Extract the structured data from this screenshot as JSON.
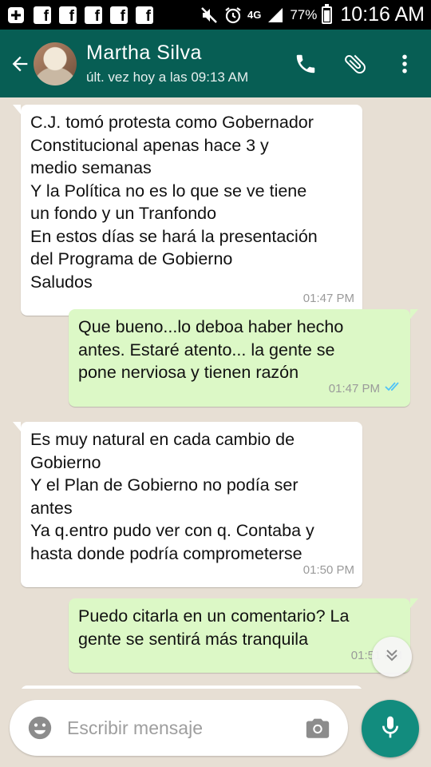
{
  "status_bar": {
    "network": "4G",
    "battery": "77%",
    "battery_level": 0.77,
    "time": "10:16 AM",
    "icons": [
      "plus-box-icon",
      "facebook-icon",
      "facebook-icon",
      "facebook-icon",
      "facebook-icon",
      "facebook-icon",
      "mute-icon",
      "alarm-icon",
      "signal-icon",
      "battery-icon"
    ]
  },
  "header": {
    "contact_name": "Martha Silva",
    "last_seen": "últ. vez hoy a las 09:13 AM",
    "icons": [
      "back-arrow-icon",
      "phone-icon",
      "paperclip-icon",
      "more-vert-icon"
    ],
    "color": "#075e54"
  },
  "messages": [
    {
      "direction": "in",
      "lines": [
        "C.J. tomó protesta como Gobernador",
        "Constitucional apenas hace 3 y",
        "medio semanas",
        "Y la Política no es lo que se ve tiene",
        "un fondo y un Tranfondo",
        "En estos días se hará la presentación",
        "del Programa de Gobierno",
        "Saludos"
      ],
      "time": "01:47 PM"
    },
    {
      "direction": "out",
      "lines": [
        "Que bueno...lo deboa haber hecho",
        "antes. Estaré atento... la gente se",
        "pone nerviosa y tienen razón"
      ],
      "time": "01:47 PM",
      "read": true
    },
    {
      "direction": "in",
      "lines": [
        "Es muy natural en cada cambio de",
        "Gobierno",
        "Y el Plan de Gobierno no podía ser",
        "antes",
        "Ya q.entro pudo ver con q. Contaba y",
        "hasta donde podría comprometerse"
      ],
      "time": "01:50 PM"
    },
    {
      "direction": "out",
      "lines": [
        "Puedo citarla en un comentario? La",
        "gente se sentirá más tranquila"
      ],
      "time": "01:51 PM"
    }
  ],
  "composer": {
    "placeholder": "Escribir mensaje",
    "icons": [
      "emoji-icon",
      "camera-icon",
      "mic-icon"
    ],
    "accent": "#128c7e"
  },
  "colors": {
    "incoming_bubble": "#ffffff",
    "outgoing_bubble": "#dcf8c6",
    "wallpaper": "#e7dfd4",
    "read_ticks": "#4fc3f7"
  }
}
